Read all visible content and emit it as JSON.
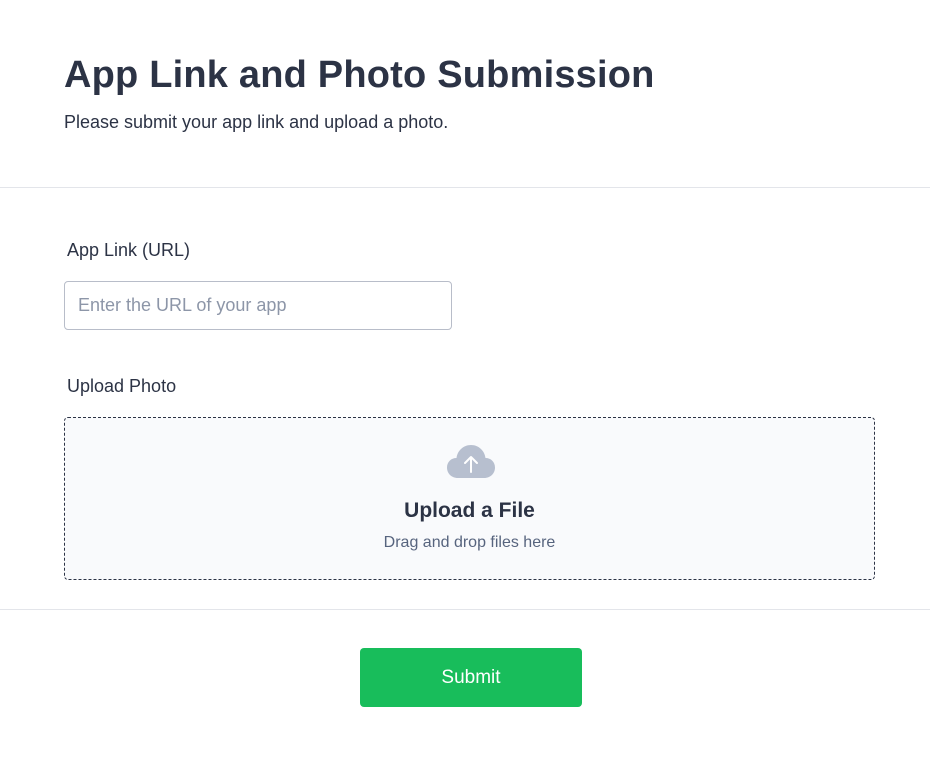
{
  "header": {
    "title": "App Link and Photo Submission",
    "subtitle": "Please submit your app link and upload a photo."
  },
  "form": {
    "app_link": {
      "label": "App Link (URL)",
      "value": "",
      "placeholder": "Enter the URL of your app"
    },
    "upload": {
      "label": "Upload Photo",
      "icon": "cloud-upload-icon",
      "title": "Upload a File",
      "subtitle": "Drag and drop files here"
    },
    "submit_label": "Submit"
  },
  "colors": {
    "text": "#2c3345",
    "accent": "#18bd5b",
    "icon": "#b7bfcf",
    "dropzone_bg": "#f9fafc"
  }
}
